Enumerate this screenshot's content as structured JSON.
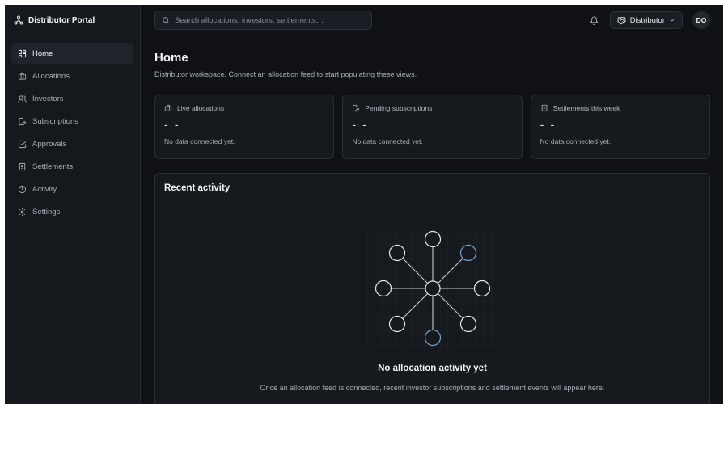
{
  "brand": {
    "name": "Distributor Portal"
  },
  "nav": {
    "items": [
      {
        "label": "Home",
        "icon": "grid-icon",
        "active": true
      },
      {
        "label": "Allocations",
        "icon": "briefcase-icon"
      },
      {
        "label": "Investors",
        "icon": "users-icon"
      },
      {
        "label": "Subscriptions",
        "icon": "file-edit-icon"
      },
      {
        "label": "Approvals",
        "icon": "check-square-icon"
      },
      {
        "label": "Settlements",
        "icon": "receipt-icon"
      },
      {
        "label": "Activity",
        "icon": "history-icon"
      },
      {
        "label": "Settings",
        "icon": "gear-icon"
      }
    ]
  },
  "topbar": {
    "search_placeholder": "Search allocations, investors, settlements…",
    "role_label": "Distributor",
    "avatar_initials": "DO"
  },
  "page": {
    "title": "Home",
    "subtitle": "Distributor workspace. Connect an allocation feed to start populating these views."
  },
  "cards": [
    {
      "label": "Live allocations",
      "value": "- -",
      "note": "No data connected yet.",
      "icon": "briefcase-icon"
    },
    {
      "label": "Pending subscriptions",
      "value": "- -",
      "note": "No data connected yet.",
      "icon": "file-edit-icon"
    },
    {
      "label": "Settlements this week",
      "value": "- -",
      "note": "No data connected yet.",
      "icon": "receipt-icon"
    }
  ],
  "activity": {
    "title": "Recent activity",
    "empty_title": "No allocation activity yet",
    "empty_subtitle": "Once an allocation feed is connected, recent investor subscriptions and settlement events will appear here."
  },
  "colors": {
    "background": "#0f1115",
    "sidebar": "#15181d",
    "card": "#16191e",
    "accent_node": "#7aa2d6"
  }
}
